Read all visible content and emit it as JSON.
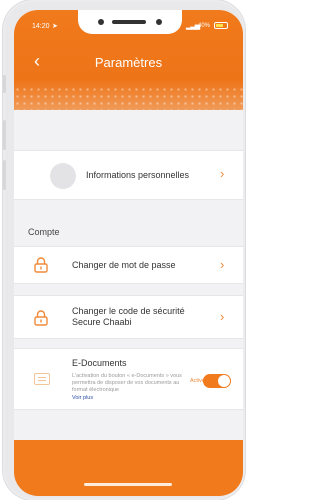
{
  "status_bar": {
    "time": "14:20",
    "battery_percent": "40%"
  },
  "header": {
    "title": "Paramètres",
    "back_icon": "chevron-left-icon"
  },
  "rows": {
    "personal_info": {
      "label": "Informations personnelles"
    },
    "section_compte": "Compte",
    "change_password": {
      "label": "Changer de mot de passe"
    },
    "change_security_code": {
      "line1": "Changer le code de sécurité",
      "line2": "Secure Chaabi"
    },
    "edocuments": {
      "title": "E-Documents",
      "description": "L'activation du bouton « e-Documents » vous permettra de disposer de vos documents au format électronique",
      "link": "Voir plus",
      "toggle_label": "Activé",
      "toggle_on": true
    }
  },
  "colors": {
    "accent": "#f07a1c",
    "link": "#2a4fa8"
  }
}
